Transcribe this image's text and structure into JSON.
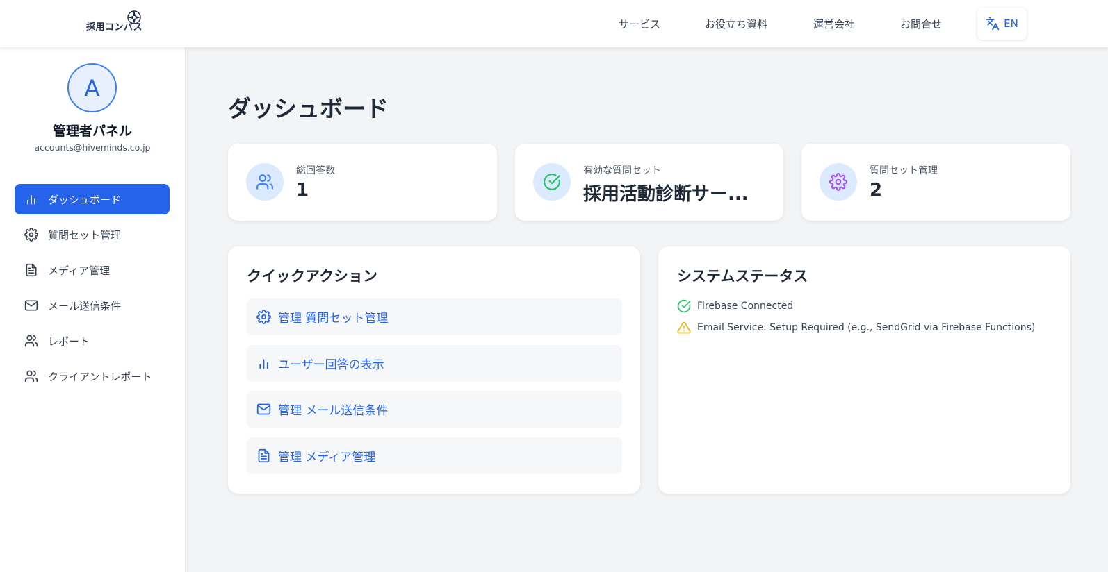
{
  "header": {
    "logo_text": "採用コンパス",
    "nav": [
      "サービス",
      "お役立ち資料",
      "運営会社",
      "お問合せ"
    ],
    "lang_label": "EN"
  },
  "sidebar": {
    "avatar_initial": "A",
    "title": "管理者パネル",
    "email": "accounts@hiveminds.co.jp",
    "items": [
      {
        "label": "ダッシュボード",
        "icon": "bar-chart-icon"
      },
      {
        "label": "質問セット管理",
        "icon": "gear-icon"
      },
      {
        "label": "メディア管理",
        "icon": "document-icon"
      },
      {
        "label": "メール送信条件",
        "icon": "mail-icon"
      },
      {
        "label": "レポート",
        "icon": "users-icon"
      },
      {
        "label": "クライアントレポート",
        "icon": "users-icon"
      }
    ]
  },
  "main": {
    "title": "ダッシュボード",
    "stats": [
      {
        "label": "総回答数",
        "value": "1",
        "icon": "users-icon"
      },
      {
        "label": "有効な質問セット",
        "value": "採用活動診断サー...",
        "icon": "check-circle-icon"
      },
      {
        "label": "質問セット管理",
        "value": "2",
        "icon": "gear-icon"
      }
    ],
    "quick_actions": {
      "title": "クイックアクション",
      "items": [
        {
          "label": "管理 質問セット管理",
          "icon": "gear-icon"
        },
        {
          "label": "ユーザー回答の表示",
          "icon": "bar-chart-icon"
        },
        {
          "label": "管理 メール送信条件",
          "icon": "mail-icon"
        },
        {
          "label": "管理 メディア管理",
          "icon": "document-icon"
        }
      ]
    },
    "system_status": {
      "title": "システムステータス",
      "items": [
        {
          "text": "Firebase Connected",
          "icon": "check-circle-icon",
          "color": "#22c55e"
        },
        {
          "text": "Email Service: Setup Required (e.g., SendGrid via Firebase Functions)",
          "icon": "warning-icon",
          "color": "#eab308"
        }
      ]
    }
  },
  "colors": {
    "primary": "#2563eb",
    "success": "#22c55e",
    "warning": "#eab308",
    "accent_purple": "#a855f7"
  }
}
